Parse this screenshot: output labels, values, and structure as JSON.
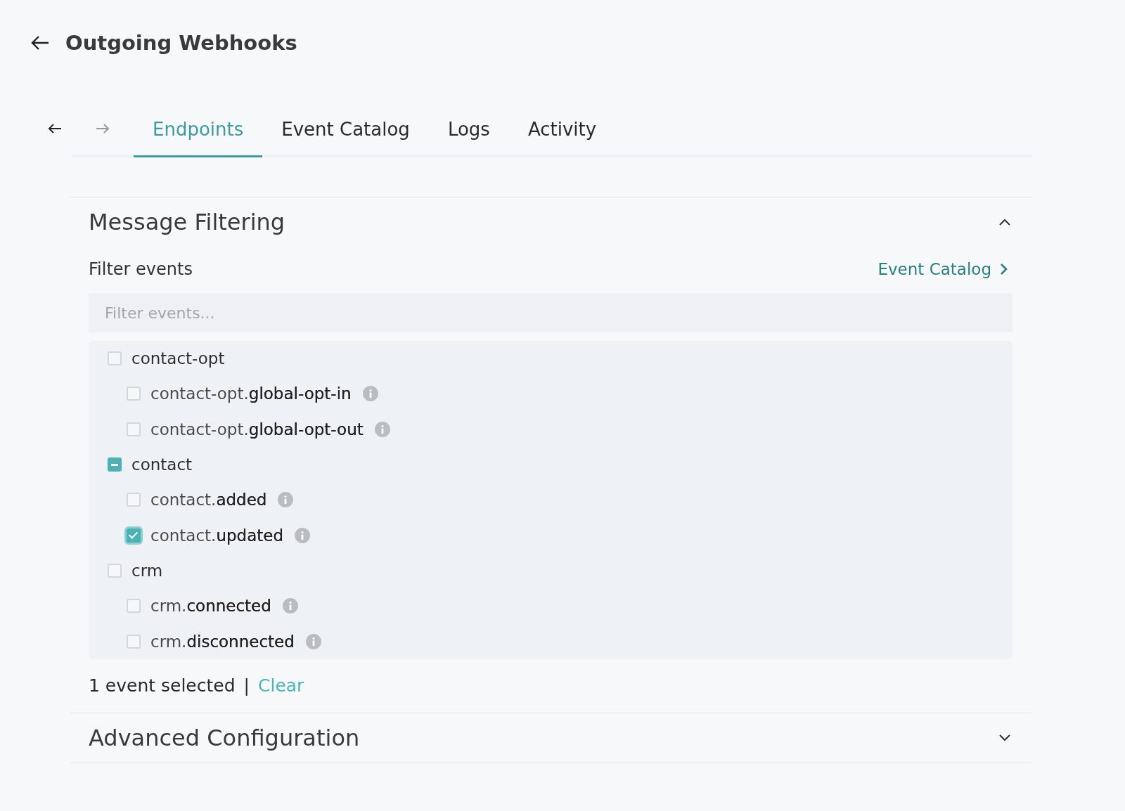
{
  "header": {
    "title": "Outgoing Webhooks"
  },
  "tabs": [
    {
      "label": "Endpoints",
      "selected": true
    },
    {
      "label": "Event Catalog",
      "selected": false
    },
    {
      "label": "Logs",
      "selected": false
    },
    {
      "label": "Activity",
      "selected": false
    }
  ],
  "sections": [
    {
      "title": "Message Filtering",
      "expanded": true,
      "filter_label": "Filter events",
      "catalog_link": "Event Catalog",
      "search": {
        "placeholder": "Filter events..."
      },
      "events": [
        {
          "label": "contact-opt",
          "indeterminate": false,
          "children": [
            {
              "label": "contact-opt.**global-opt-in**",
              "checked": false
            },
            {
              "label": "contact-opt.**global-opt-out**",
              "checked": false
            }
          ]
        },
        {
          "label": "contact",
          "indeterminate": true,
          "children": [
            {
              "label": "contact.**added**",
              "checked": false
            },
            {
              "label": "contact.**updated**",
              "checked": true
            }
          ]
        },
        {
          "label": "crm",
          "indeterminate": false,
          "children": [
            {
              "label": "crm.**connected**",
              "checked": false
            },
            {
              "label": "crm.**disconnected**",
              "checked": false
            }
          ]
        }
      ],
      "summary": "1 event selected",
      "separator": "|",
      "clear": "Clear"
    },
    {
      "title": "Advanced Configuration",
      "expanded": false
    }
  ]
}
